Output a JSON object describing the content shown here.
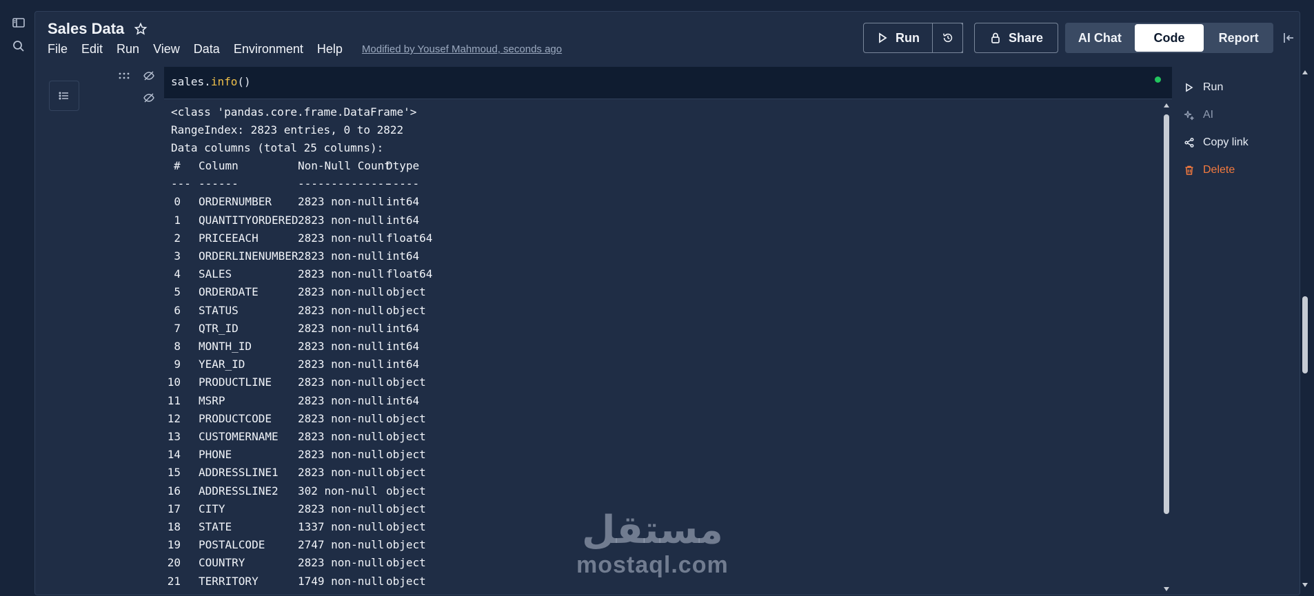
{
  "app": {
    "title": "Sales Data",
    "menu": [
      "File",
      "Edit",
      "Run",
      "View",
      "Data",
      "Environment",
      "Help"
    ],
    "modified_text": "Modified by Yousef Mahmoud, seconds ago"
  },
  "toolbar": {
    "run_label": "Run",
    "share_label": "Share",
    "views": [
      "AI Chat",
      "Code",
      "Report"
    ],
    "active_view": "Code"
  },
  "cell": {
    "code_object": "sales",
    "code_dot": ".",
    "code_method": "info",
    "code_parens": "()",
    "status_color": "#22c55e"
  },
  "output": {
    "class_line": "<class 'pandas.core.frame.DataFrame'>",
    "range_line": "RangeIndex: 2823 entries, 0 to 2822",
    "columns_line": "Data columns (total 25 columns):",
    "headers": [
      "#",
      "Column",
      "Non-Null Count",
      "Dtype"
    ],
    "separators": [
      "---",
      "------",
      "--------------",
      "-----"
    ],
    "rows": [
      {
        "idx": "0",
        "name": "ORDERNUMBER",
        "count": "2823 non-null",
        "dtype": "int64"
      },
      {
        "idx": "1",
        "name": "QUANTITYORDERED",
        "count": "2823 non-null",
        "dtype": "int64"
      },
      {
        "idx": "2",
        "name": "PRICEEACH",
        "count": "2823 non-null",
        "dtype": "float64"
      },
      {
        "idx": "3",
        "name": "ORDERLINENUMBER",
        "count": "2823 non-null",
        "dtype": "int64"
      },
      {
        "idx": "4",
        "name": "SALES",
        "count": "2823 non-null",
        "dtype": "float64"
      },
      {
        "idx": "5",
        "name": "ORDERDATE",
        "count": "2823 non-null",
        "dtype": "object"
      },
      {
        "idx": "6",
        "name": "STATUS",
        "count": "2823 non-null",
        "dtype": "object"
      },
      {
        "idx": "7",
        "name": "QTR_ID",
        "count": "2823 non-null",
        "dtype": "int64"
      },
      {
        "idx": "8",
        "name": "MONTH_ID",
        "count": "2823 non-null",
        "dtype": "int64"
      },
      {
        "idx": "9",
        "name": "YEAR_ID",
        "count": "2823 non-null",
        "dtype": "int64"
      },
      {
        "idx": "10",
        "name": "PRODUCTLINE",
        "count": "2823 non-null",
        "dtype": "object"
      },
      {
        "idx": "11",
        "name": "MSRP",
        "count": "2823 non-null",
        "dtype": "int64"
      },
      {
        "idx": "12",
        "name": "PRODUCTCODE",
        "count": "2823 non-null",
        "dtype": "object"
      },
      {
        "idx": "13",
        "name": "CUSTOMERNAME",
        "count": "2823 non-null",
        "dtype": "object"
      },
      {
        "idx": "14",
        "name": "PHONE",
        "count": "2823 non-null",
        "dtype": "object"
      },
      {
        "idx": "15",
        "name": "ADDRESSLINE1",
        "count": "2823 non-null",
        "dtype": "object"
      },
      {
        "idx": "16",
        "name": "ADDRESSLINE2",
        "count": "302 non-null",
        "dtype": "object"
      },
      {
        "idx": "17",
        "name": "CITY",
        "count": "2823 non-null",
        "dtype": "object"
      },
      {
        "idx": "18",
        "name": "STATE",
        "count": "1337 non-null",
        "dtype": "object"
      },
      {
        "idx": "19",
        "name": "POSTALCODE",
        "count": "2747 non-null",
        "dtype": "object"
      },
      {
        "idx": "20",
        "name": "COUNTRY",
        "count": "2823 non-null",
        "dtype": "object"
      },
      {
        "idx": "21",
        "name": "TERRITORY",
        "count": "1749 non-null",
        "dtype": "object"
      }
    ]
  },
  "cell_actions": [
    {
      "label": "Run",
      "icon": "play-icon",
      "style": "normal"
    },
    {
      "label": "AI",
      "icon": "sparkle-icon",
      "style": "muted"
    },
    {
      "label": "Copy link",
      "icon": "share-icon",
      "style": "normal"
    },
    {
      "label": "Delete",
      "icon": "trash-icon",
      "style": "danger"
    }
  ],
  "watermark": {
    "arabic": "مستقل",
    "latin": "mostaql.com"
  }
}
